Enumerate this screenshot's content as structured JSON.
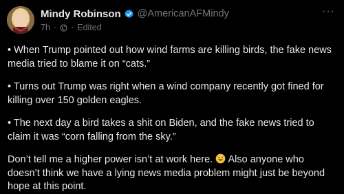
{
  "post": {
    "author_name": "Mindy Robinson",
    "handle": "@AmericanAFMindy",
    "time": "7h",
    "edited_label": "Edited",
    "more_label": "···",
    "paragraphs": [
      "• When Trump pointed out how wind farms are killing birds, the fake news media tried to blame it on “cats.”",
      "• Turns out Trump was right when a wind company recently got fined for killing over 150 golden eagles.",
      "• The next day a bird takes a shit on Biden, and the fake news tried to claim it was “corn falling from the sky.”"
    ],
    "last_para_before_emoji": "Don’t tell me a higher power isn’t at work here. ",
    "last_para_after_emoji": " Also anyone who doesn’t think we have a lying news media problem might just be beyond hope at this point."
  },
  "icons": {
    "verified": "verified-badge-icon",
    "visibility": "globe-icon",
    "emoji": "grinning-sweat-emoji"
  },
  "colors": {
    "background": "#000000",
    "text": "#e7e9ea",
    "muted": "#71767b",
    "verified": "#1d9bf0"
  }
}
